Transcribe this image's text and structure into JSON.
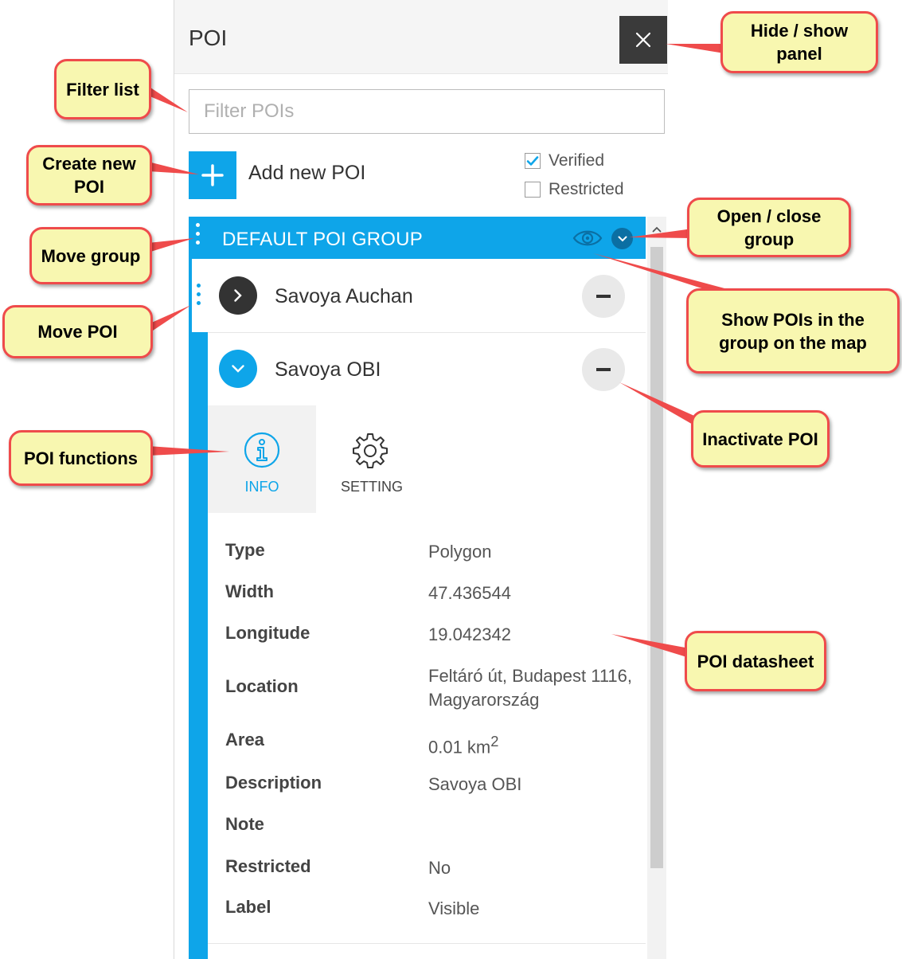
{
  "panel": {
    "title": "POI",
    "filter_placeholder": "Filter POIs",
    "add_label": "Add new POI",
    "checkboxes": [
      {
        "label": "Verified",
        "checked": true
      },
      {
        "label": "Restricted",
        "checked": false
      }
    ],
    "group": {
      "title": "DEFAULT POI GROUP"
    },
    "pois": [
      {
        "name": "Savoya Auchan",
        "expanded": false
      },
      {
        "name": "Savoya OBI",
        "expanded": true
      }
    ],
    "tabs": [
      {
        "label": "INFO",
        "active": true
      },
      {
        "label": "SETTING",
        "active": false
      }
    ],
    "datasheet": [
      {
        "label": "Type",
        "value": "Polygon"
      },
      {
        "label": "Width",
        "value": "47.436544"
      },
      {
        "label": "Longitude",
        "value": "19.042342"
      },
      {
        "label": "Location",
        "value": "Feltáró út, Budapest 1116, Magyarország"
      },
      {
        "label": "Area",
        "value": "0.01 km",
        "sup": "2"
      },
      {
        "label": "Description",
        "value": "Savoya OBI"
      },
      {
        "label": "Note",
        "value": ""
      },
      {
        "label": "Restricted",
        "value": "No"
      },
      {
        "label": "Label",
        "value": "Visible"
      }
    ]
  },
  "callouts": {
    "hide_show_panel": "Hide / show panel",
    "filter_list": "Filter list",
    "create_new_poi": "Create new POI",
    "open_close_group": "Open / close group",
    "move_group": "Move group",
    "move_poi": "Move POI",
    "show_pois_on_map": "Show POIs in the group on the map",
    "inactivate_poi": "Inactivate POI",
    "poi_functions": "POI functions",
    "poi_datasheet": "POI datasheet"
  },
  "colors": {
    "accent": "#0ea5e9",
    "dark": "#3a3a3a",
    "callout_fill": "#f8f7b0",
    "callout_border": "#ef4b4b"
  }
}
